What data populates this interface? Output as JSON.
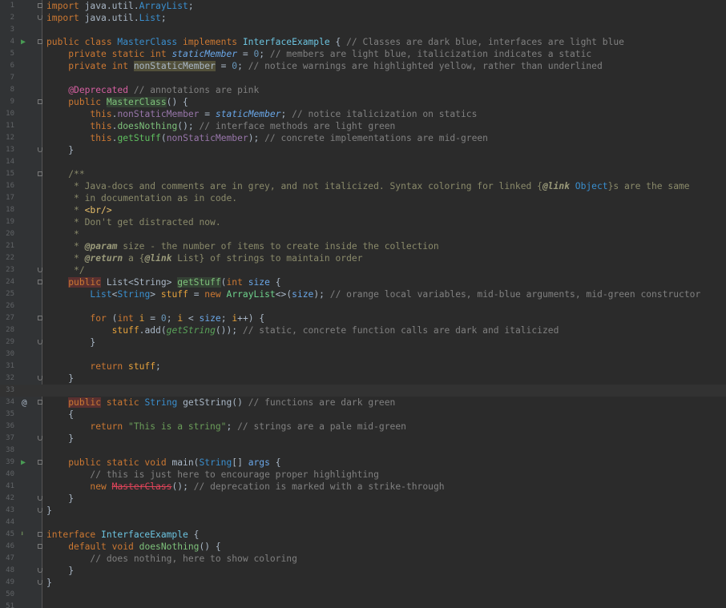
{
  "editor": {
    "language": "java",
    "current_line": 33,
    "gutter_markers": {
      "4": "run-icon",
      "34": "at-icon",
      "39": "run-icon",
      "45": "override-icon"
    },
    "lines": [
      [
        [
          "kw",
          "import "
        ],
        [
          "imp",
          "java.util."
        ],
        [
          "cls",
          "ArrayList"
        ],
        [
          "",
          "; "
        ]
      ],
      [
        [
          "kw",
          "import "
        ],
        [
          "imp",
          "java.util."
        ],
        [
          "cls",
          "List"
        ],
        [
          "",
          ";"
        ]
      ],
      [],
      [
        [
          "kw",
          "public class "
        ],
        [
          "cls",
          "MasterClass "
        ],
        [
          "kw",
          "implements "
        ],
        [
          "ifc",
          "InterfaceExample"
        ],
        [
          "",
          " { "
        ],
        [
          "cmt",
          "// Classes are dark blue, interfaces are light blue"
        ]
      ],
      [
        [
          "",
          "    "
        ],
        [
          "kw",
          "private static int "
        ],
        [
          "fld",
          "staticMember"
        ],
        [
          "",
          " = "
        ],
        [
          "num2",
          "0"
        ],
        [
          "",
          "; "
        ],
        [
          "cmt",
          "// members are light blue, italicization indicates a static"
        ]
      ],
      [
        [
          "",
          "    "
        ],
        [
          "kw",
          "private int "
        ],
        [
          "warn",
          "nonStaticMember"
        ],
        [
          "",
          " = "
        ],
        [
          "num2",
          "0"
        ],
        [
          "",
          "; "
        ],
        [
          "cmt",
          "// notice warnings are highlighted yellow, rather than underlined"
        ]
      ],
      [],
      [
        [
          "",
          "    "
        ],
        [
          "ann",
          "@Deprecated "
        ],
        [
          "cmt",
          "// annotations are pink"
        ]
      ],
      [
        [
          "",
          "    "
        ],
        [
          "kw",
          "public "
        ],
        [
          "mthhl",
          "MasterClass"
        ],
        [
          "",
          "() {"
        ]
      ],
      [
        [
          "",
          "        "
        ],
        [
          "kw",
          "this"
        ],
        [
          "",
          "."
        ],
        [
          "fld2",
          "nonStaticMember"
        ],
        [
          "",
          " = "
        ],
        [
          "fld",
          "staticMember"
        ],
        [
          "",
          "; "
        ],
        [
          "cmt",
          "// notice italicization on statics"
        ]
      ],
      [
        [
          "",
          "        "
        ],
        [
          "kw",
          "this"
        ],
        [
          "",
          "."
        ],
        [
          "meth",
          "doesNothing"
        ],
        [
          "",
          "(); "
        ],
        [
          "cmt",
          "// interface methods are light green"
        ]
      ],
      [
        [
          "",
          "        "
        ],
        [
          "kw",
          "this"
        ],
        [
          "",
          "."
        ],
        [
          "mgrn",
          "getStuff"
        ],
        [
          "",
          "("
        ],
        [
          "fld2",
          "nonStaticMember"
        ],
        [
          "",
          "); "
        ],
        [
          "cmt",
          "// concrete implementations are mid-green"
        ]
      ],
      [
        [
          "",
          "    }"
        ]
      ],
      [],
      [
        [
          "",
          "    "
        ],
        [
          "doc",
          "/**"
        ]
      ],
      [
        [
          "",
          "     "
        ],
        [
          "doc",
          "* Java-docs and comments are in grey, and not italicized. Syntax coloring for linked {"
        ],
        [
          "docb",
          "@link"
        ],
        [
          "doc",
          " "
        ],
        [
          "lnk",
          "Object"
        ],
        [
          "doc",
          "}s are the same"
        ]
      ],
      [
        [
          "",
          "     "
        ],
        [
          "doc",
          "* in documentation as in code."
        ]
      ],
      [
        [
          "",
          "     "
        ],
        [
          "doc",
          "* "
        ],
        [
          "tag",
          "<br/>"
        ]
      ],
      [
        [
          "",
          "     "
        ],
        [
          "doc",
          "* Don't get distracted now."
        ]
      ],
      [
        [
          "",
          "     "
        ],
        [
          "doc",
          "*"
        ]
      ],
      [
        [
          "",
          "     "
        ],
        [
          "doc",
          "* "
        ],
        [
          "docb",
          "@param"
        ],
        [
          "doc",
          " size - the number of items to create inside the collection"
        ]
      ],
      [
        [
          "",
          "     "
        ],
        [
          "doc",
          "* "
        ],
        [
          "docb",
          "@return"
        ],
        [
          "doc",
          " a {"
        ],
        [
          "docb",
          "@link"
        ],
        [
          "doc",
          " List} of strings to maintain order"
        ]
      ],
      [
        [
          "",
          "     "
        ],
        [
          "doc",
          "*/"
        ]
      ],
      [
        [
          "",
          "    "
        ],
        [
          "pubhl",
          "public"
        ],
        [
          "",
          " List<String> "
        ],
        [
          "mthhl",
          "getStuff"
        ],
        [
          "",
          "("
        ],
        [
          "kw",
          "int "
        ],
        [
          "arg",
          "size"
        ],
        [
          "",
          " {"
        ]
      ],
      [
        [
          "",
          "        "
        ],
        [
          "cls",
          "List"
        ],
        [
          "",
          "<"
        ],
        [
          "cls",
          "String"
        ],
        [
          "",
          "> "
        ],
        [
          "loc",
          "stuff"
        ],
        [
          "",
          " = "
        ],
        [
          "kw",
          "new "
        ],
        [
          "cstr",
          "ArrayList"
        ],
        [
          "",
          "<>("
        ],
        [
          "arg",
          "size"
        ],
        [
          "",
          "); "
        ],
        [
          "cmt",
          "// orange local variables, mid-blue arguments, mid-green constructor"
        ]
      ],
      [],
      [
        [
          "",
          "        "
        ],
        [
          "kw",
          "for "
        ],
        [
          "",
          "("
        ],
        [
          "kw",
          "int "
        ],
        [
          "loc",
          "i"
        ],
        [
          "",
          " = "
        ],
        [
          "num2",
          "0"
        ],
        [
          "",
          "; "
        ],
        [
          "loc",
          "i"
        ],
        [
          "",
          " < "
        ],
        [
          "arg",
          "size"
        ],
        [
          "",
          "; "
        ],
        [
          "loc",
          "i"
        ],
        [
          "",
          "++) {"
        ]
      ],
      [
        [
          "",
          "            "
        ],
        [
          "loc",
          "stuff"
        ],
        [
          "",
          ".add("
        ],
        [
          "stat",
          "getString"
        ],
        [
          "",
          "()); "
        ],
        [
          "cmt",
          "// static, concrete function calls are dark and italicized"
        ]
      ],
      [
        [
          "",
          "        }"
        ]
      ],
      [],
      [
        [
          "",
          "        "
        ],
        [
          "kw",
          "return "
        ],
        [
          "loc",
          "stuff"
        ],
        [
          "",
          ";"
        ]
      ],
      [
        [
          "",
          "    }"
        ]
      ],
      [],
      [
        [
          "",
          "    "
        ],
        [
          "pubhl",
          "public"
        ],
        [
          "kw",
          " static "
        ],
        [
          "cls",
          "String "
        ],
        [
          "",
          "getString() "
        ],
        [
          "cmt",
          "// functions are dark green"
        ]
      ],
      [
        [
          "",
          "    {"
        ]
      ],
      [
        [
          "",
          "        "
        ],
        [
          "kw",
          "return "
        ],
        [
          "str",
          "\"This is a string\""
        ],
        [
          "",
          "; "
        ],
        [
          "cmt",
          "// strings are a pale mid-green"
        ]
      ],
      [
        [
          "",
          "    }"
        ]
      ],
      [],
      [
        [
          "",
          "    "
        ],
        [
          "kw",
          "public static void "
        ],
        [
          "",
          "main("
        ],
        [
          "cls",
          "String"
        ],
        [
          "",
          "[] "
        ],
        [
          "arg",
          "args"
        ],
        [
          "",
          " {"
        ]
      ],
      [
        [
          "",
          "        "
        ],
        [
          "cmt",
          "// this is just here to encourage proper highlighting"
        ]
      ],
      [
        [
          "",
          "        "
        ],
        [
          "kw",
          "new "
        ],
        [
          "depr",
          "MasterClass"
        ],
        [
          "",
          "(); "
        ],
        [
          "cmt",
          "// deprecation is marked with a strike-through"
        ]
      ],
      [
        [
          "",
          "    }"
        ]
      ],
      [
        [
          "",
          "}"
        ]
      ],
      [],
      [
        [
          "kw",
          "interface "
        ],
        [
          "ifc",
          "InterfaceExample"
        ],
        [
          "",
          " {"
        ]
      ],
      [
        [
          "",
          "    "
        ],
        [
          "kw",
          "default void "
        ],
        [
          "meth",
          "doesNothing"
        ],
        [
          "",
          "() {"
        ]
      ],
      [
        [
          "",
          "        "
        ],
        [
          "cmt",
          "// does nothing, here to show coloring"
        ]
      ],
      [
        [
          "",
          "    }"
        ]
      ],
      [
        [
          "",
          "}"
        ]
      ],
      [],
      []
    ],
    "fold_start_lines": [
      1,
      4,
      9,
      15,
      24,
      27,
      34,
      39,
      45,
      46
    ],
    "fold_end_lines": [
      2,
      13,
      23,
      29,
      32,
      37,
      42,
      43,
      48,
      49
    ]
  }
}
